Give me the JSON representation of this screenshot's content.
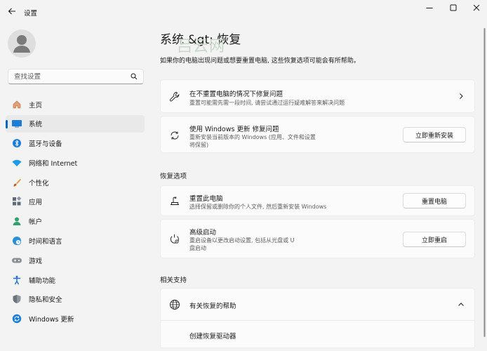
{
  "window": {
    "title": "设置"
  },
  "sidebar": {
    "search_placeholder": "查找设置",
    "items": [
      {
        "label": "主页",
        "icon": "home-icon"
      },
      {
        "label": "系统",
        "icon": "system-icon",
        "selected": true
      },
      {
        "label": "蓝牙与设备",
        "icon": "bluetooth-icon"
      },
      {
        "label": "网络和 Internet",
        "icon": "wifi-icon"
      },
      {
        "label": "个性化",
        "icon": "brush-icon"
      },
      {
        "label": "应用",
        "icon": "apps-icon"
      },
      {
        "label": "帐户",
        "icon": "account-icon"
      },
      {
        "label": "时间和语言",
        "icon": "globe-clock-icon"
      },
      {
        "label": "游戏",
        "icon": "gamepad-icon"
      },
      {
        "label": "辅助功能",
        "icon": "accessibility-icon"
      },
      {
        "label": "隐私和安全",
        "icon": "shield-icon"
      },
      {
        "label": "Windows 更新",
        "icon": "update-icon"
      }
    ]
  },
  "main": {
    "title": "系统 &gt; 恢复",
    "watermark": "吕云网",
    "description": "如果你的电脑出现问题或想要重置电脑, 这些恢复选项可能会有所帮助。",
    "top_cards": [
      {
        "title": "在不重置电脑的情况下修复问题",
        "subtitle": "重置可能需先需一段时间, 请尝试通过运行疑难解答来解决问题"
      },
      {
        "title": "使用 Windows 更新 修复问题",
        "subtitle_line1": "重新安装当前版本的 Windows (应用、文件和设置",
        "subtitle_line2": "将保留)",
        "button": "立即重新安装"
      }
    ],
    "recovery_heading": "恢复选项",
    "recovery_cards": [
      {
        "title": "重置此电脑",
        "subtitle": "选择保留或删除你的个人文件, 然后重新安装 Windows",
        "button": "重置电脑"
      },
      {
        "title": "高级启动",
        "subtitle_line1": "重启设备以更改启动设置, 包括从光盘或 U",
        "subtitle_line2": "盘启动",
        "button": "立即重启"
      }
    ],
    "support_heading": "相关支持",
    "support_card": {
      "title": "有关恢复的帮助",
      "sub_item": "创建恢复驱动器"
    }
  },
  "colors": {
    "accent": "#0067c0",
    "background": "#f3f3f3",
    "card": "#fbfbfb"
  }
}
